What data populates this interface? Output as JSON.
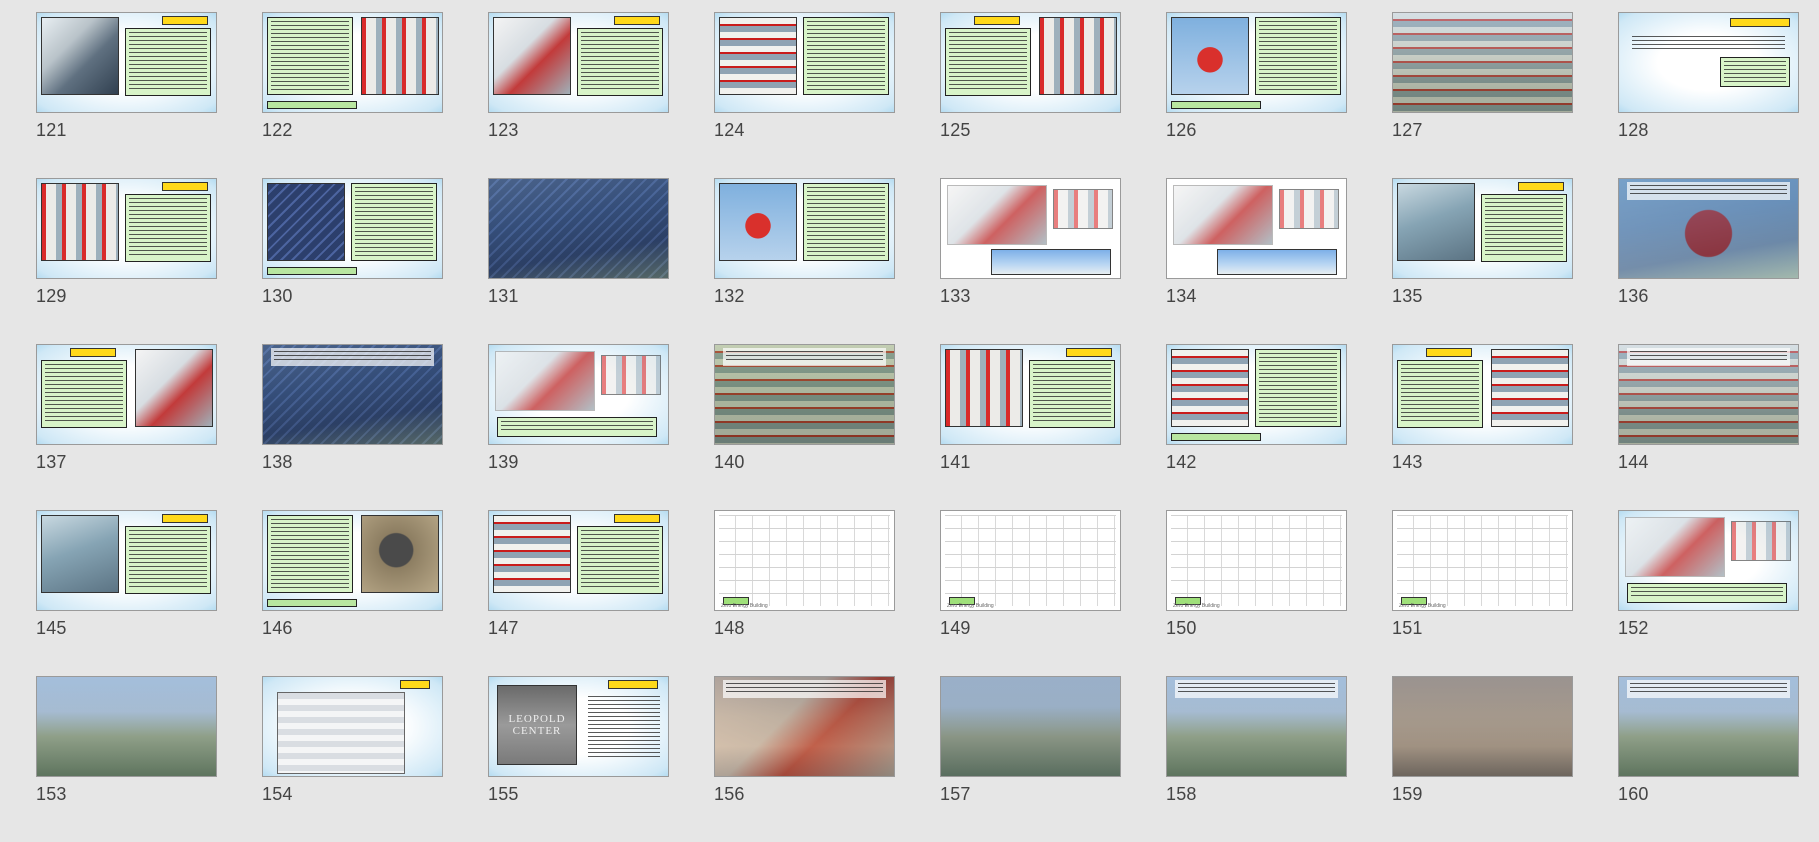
{
  "slides": [
    {
      "n": "121",
      "kind": "photo-text",
      "bg": "ice"
    },
    {
      "n": "122",
      "kind": "photo-text",
      "bg": "ice"
    },
    {
      "n": "123",
      "kind": "diagram-text",
      "bg": "ice"
    },
    {
      "n": "124",
      "kind": "photo-text",
      "bg": "ice"
    },
    {
      "n": "125",
      "kind": "photo-text",
      "bg": "ice"
    },
    {
      "n": "126",
      "kind": "photo-text",
      "bg": "ice"
    },
    {
      "n": "127",
      "kind": "full-photo",
      "bg": "build"
    },
    {
      "n": "128",
      "kind": "text-only",
      "bg": "ice"
    },
    {
      "n": "129",
      "kind": "photo-text",
      "bg": "ice"
    },
    {
      "n": "130",
      "kind": "photo-text",
      "bg": "ice"
    },
    {
      "n": "131",
      "kind": "full-photo",
      "bg": "solar"
    },
    {
      "n": "132",
      "kind": "photo-text",
      "bg": "ice"
    },
    {
      "n": "133",
      "kind": "drawing",
      "bg": "white"
    },
    {
      "n": "134",
      "kind": "drawing",
      "bg": "white"
    },
    {
      "n": "135",
      "kind": "photo-text",
      "bg": "ice"
    },
    {
      "n": "136",
      "kind": "full-photo",
      "bg": "solar"
    },
    {
      "n": "137",
      "kind": "diagram-text",
      "bg": "ice"
    },
    {
      "n": "138",
      "kind": "full-photo",
      "bg": "solar"
    },
    {
      "n": "139",
      "kind": "drawing-text",
      "bg": "ice"
    },
    {
      "n": "140",
      "kind": "full-photo",
      "bg": "green"
    },
    {
      "n": "141",
      "kind": "photo-text",
      "bg": "ice"
    },
    {
      "n": "142",
      "kind": "photo-text",
      "bg": "ice"
    },
    {
      "n": "143",
      "kind": "photo-text",
      "bg": "ice"
    },
    {
      "n": "144",
      "kind": "full-photo",
      "bg": "build"
    },
    {
      "n": "145",
      "kind": "photo-text",
      "bg": "ice"
    },
    {
      "n": "146",
      "kind": "photo-text",
      "bg": "ice"
    },
    {
      "n": "147",
      "kind": "photo-text",
      "bg": "ice"
    },
    {
      "n": "148",
      "kind": "plan",
      "bg": "white",
      "caption": "Zero Energy Building"
    },
    {
      "n": "149",
      "kind": "plan",
      "bg": "white",
      "caption": "Zero Energy Building"
    },
    {
      "n": "150",
      "kind": "plan",
      "bg": "white",
      "caption": "Zero Energy Building"
    },
    {
      "n": "151",
      "kind": "plan",
      "bg": "white",
      "caption": "Zero Energy Building"
    },
    {
      "n": "152",
      "kind": "drawing-text",
      "bg": "ice"
    },
    {
      "n": "153",
      "kind": "full-photo",
      "bg": "landscape"
    },
    {
      "n": "154",
      "kind": "table",
      "bg": "ice"
    },
    {
      "n": "155",
      "kind": "sign",
      "bg": "ice",
      "sign_text": "LEOPOLD CENTER"
    },
    {
      "n": "156",
      "kind": "interior",
      "bg": "interior"
    },
    {
      "n": "157",
      "kind": "full-photo",
      "bg": "sunset"
    },
    {
      "n": "158",
      "kind": "full-photo",
      "bg": "landscape"
    },
    {
      "n": "159",
      "kind": "full-photo",
      "bg": "interior"
    },
    {
      "n": "160",
      "kind": "full-photo",
      "bg": "landscape"
    }
  ]
}
